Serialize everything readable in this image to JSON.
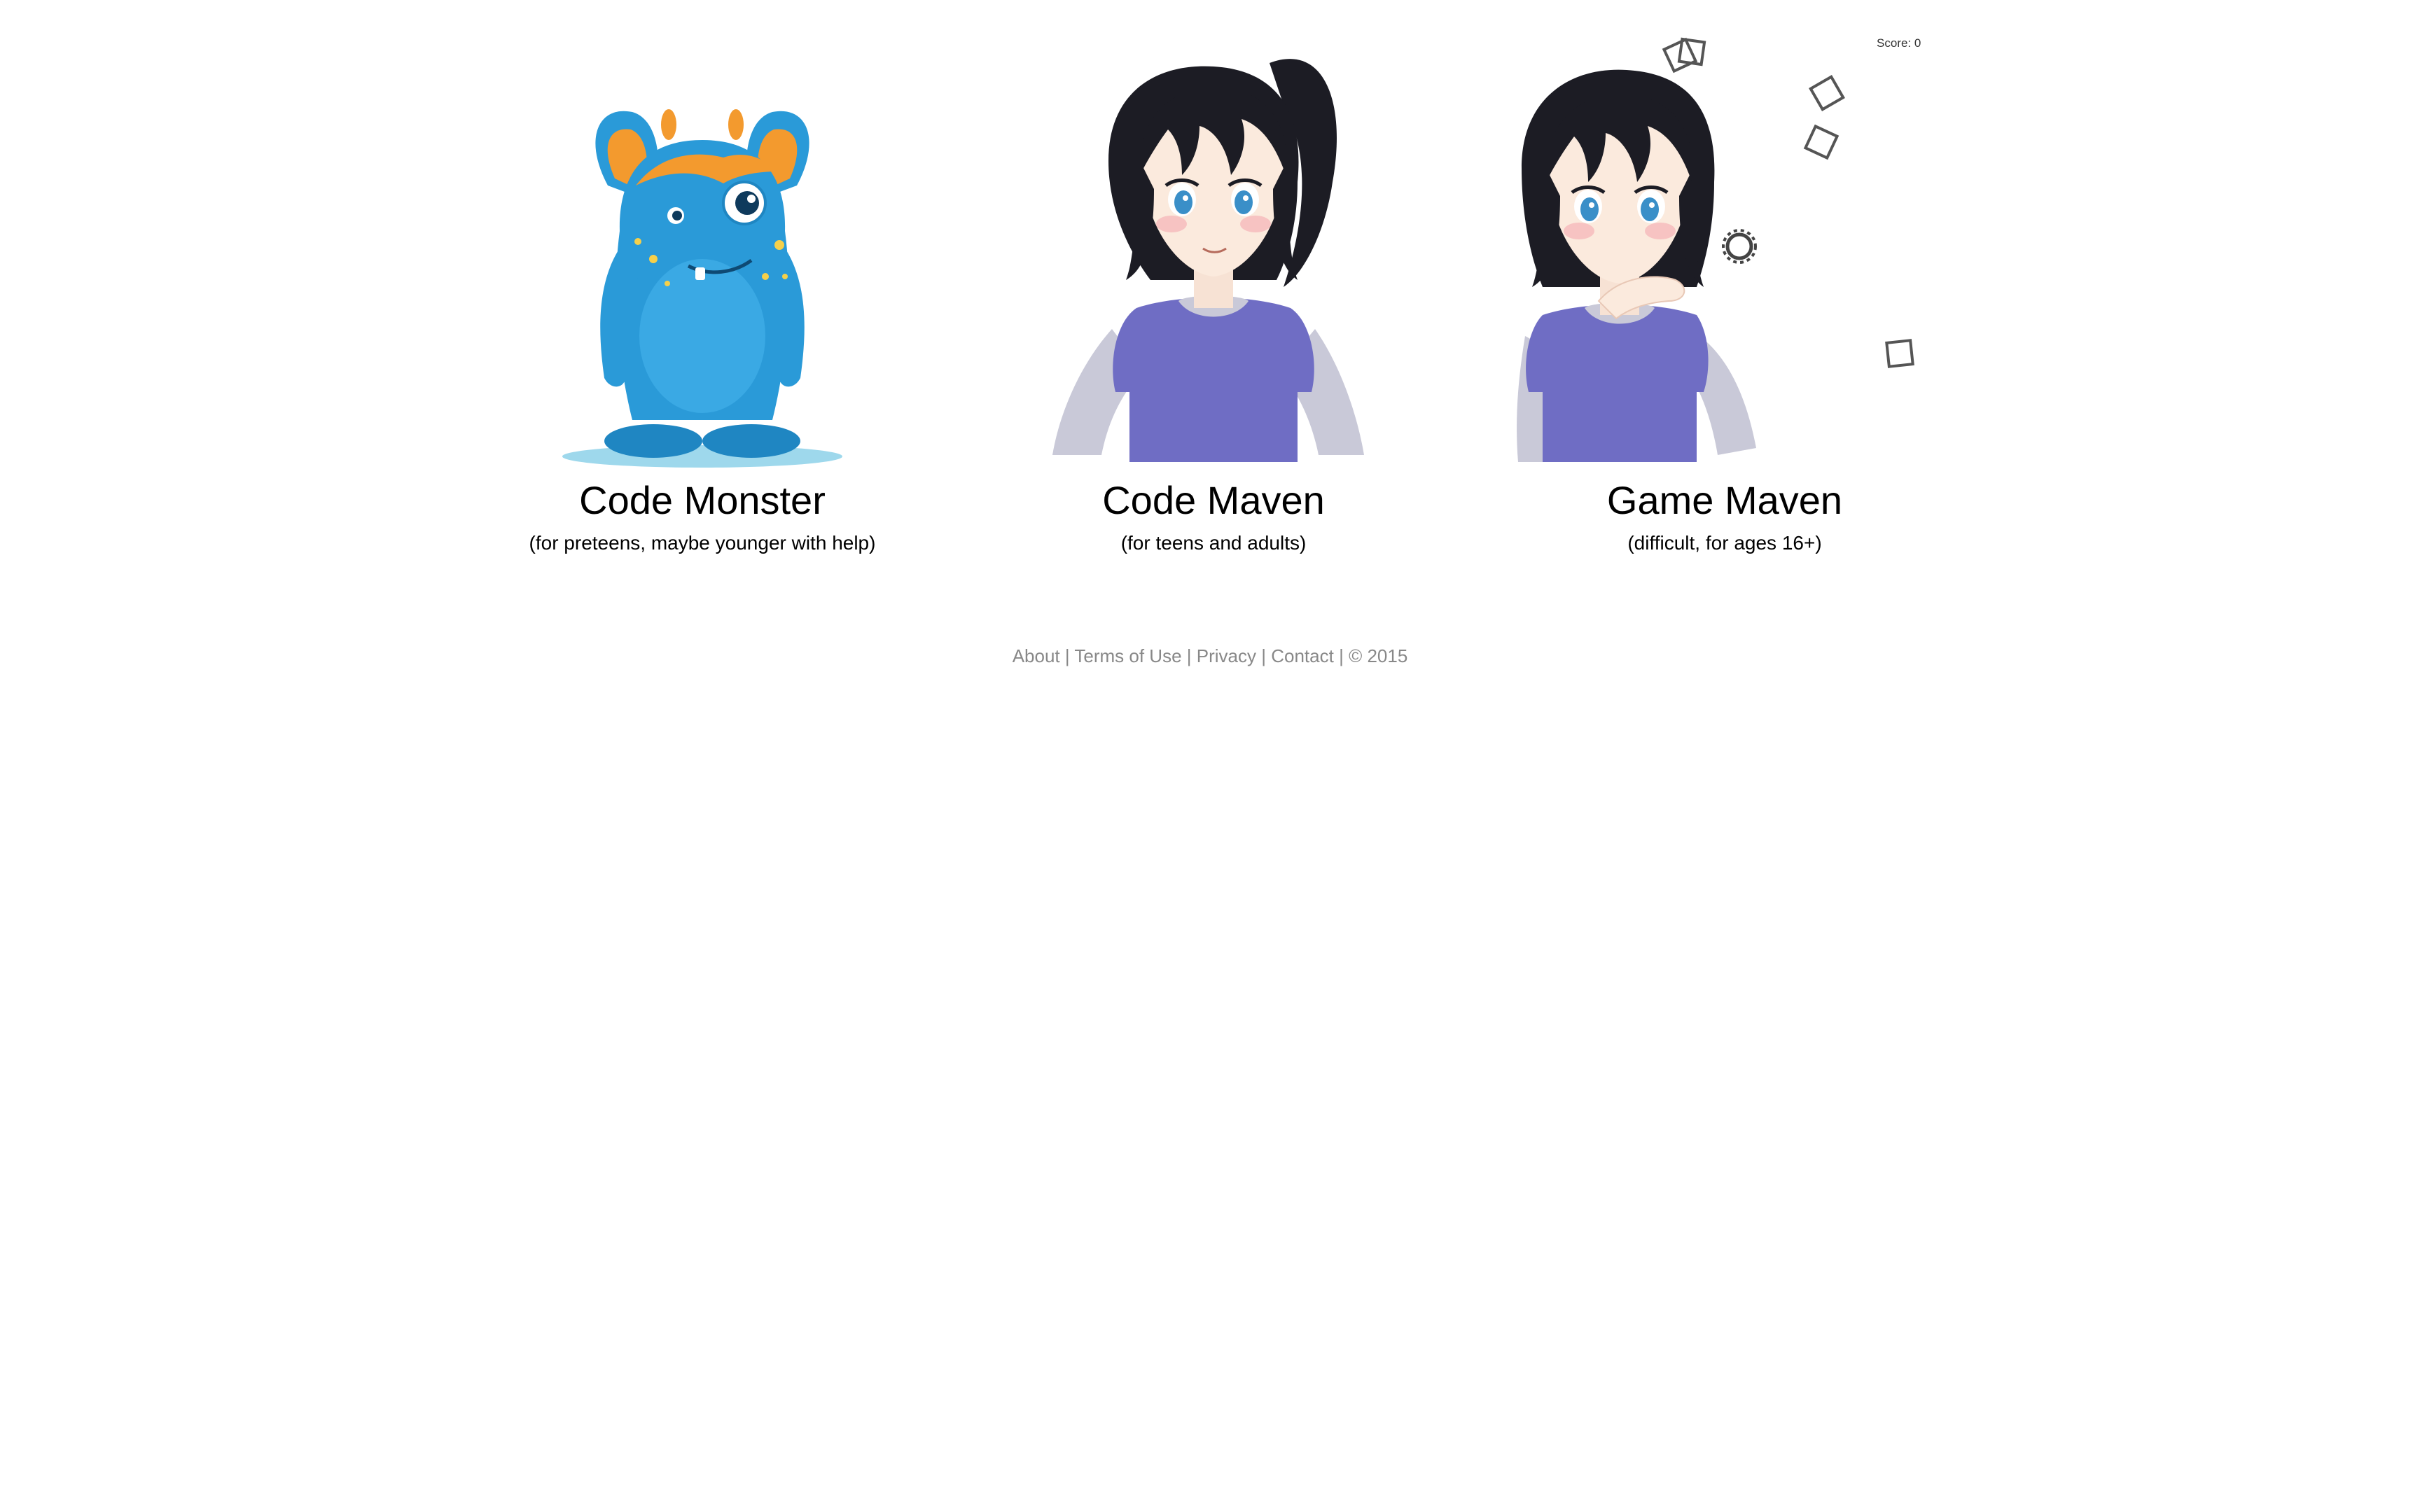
{
  "score": {
    "text": "Score: 0"
  },
  "cards": [
    {
      "title": "Code Monster",
      "subtitle": "(for preteens, maybe younger with help)"
    },
    {
      "title": "Code Maven",
      "subtitle": "(for teens and adults)"
    },
    {
      "title": "Game Maven",
      "subtitle": "(difficult, for ages 16+)"
    }
  ],
  "footer": {
    "about": "About",
    "terms": "Terms of Use",
    "privacy": "Privacy",
    "contact": "Contact",
    "separator": "|",
    "copyright": "© 2015"
  },
  "colors": {
    "monster_blue": "#2a9ad8",
    "monster_orange": "#f39a2e",
    "shirt_purple": "#6f6dc4",
    "hair_black": "#1c1c24",
    "footer_gray": "#888888"
  }
}
